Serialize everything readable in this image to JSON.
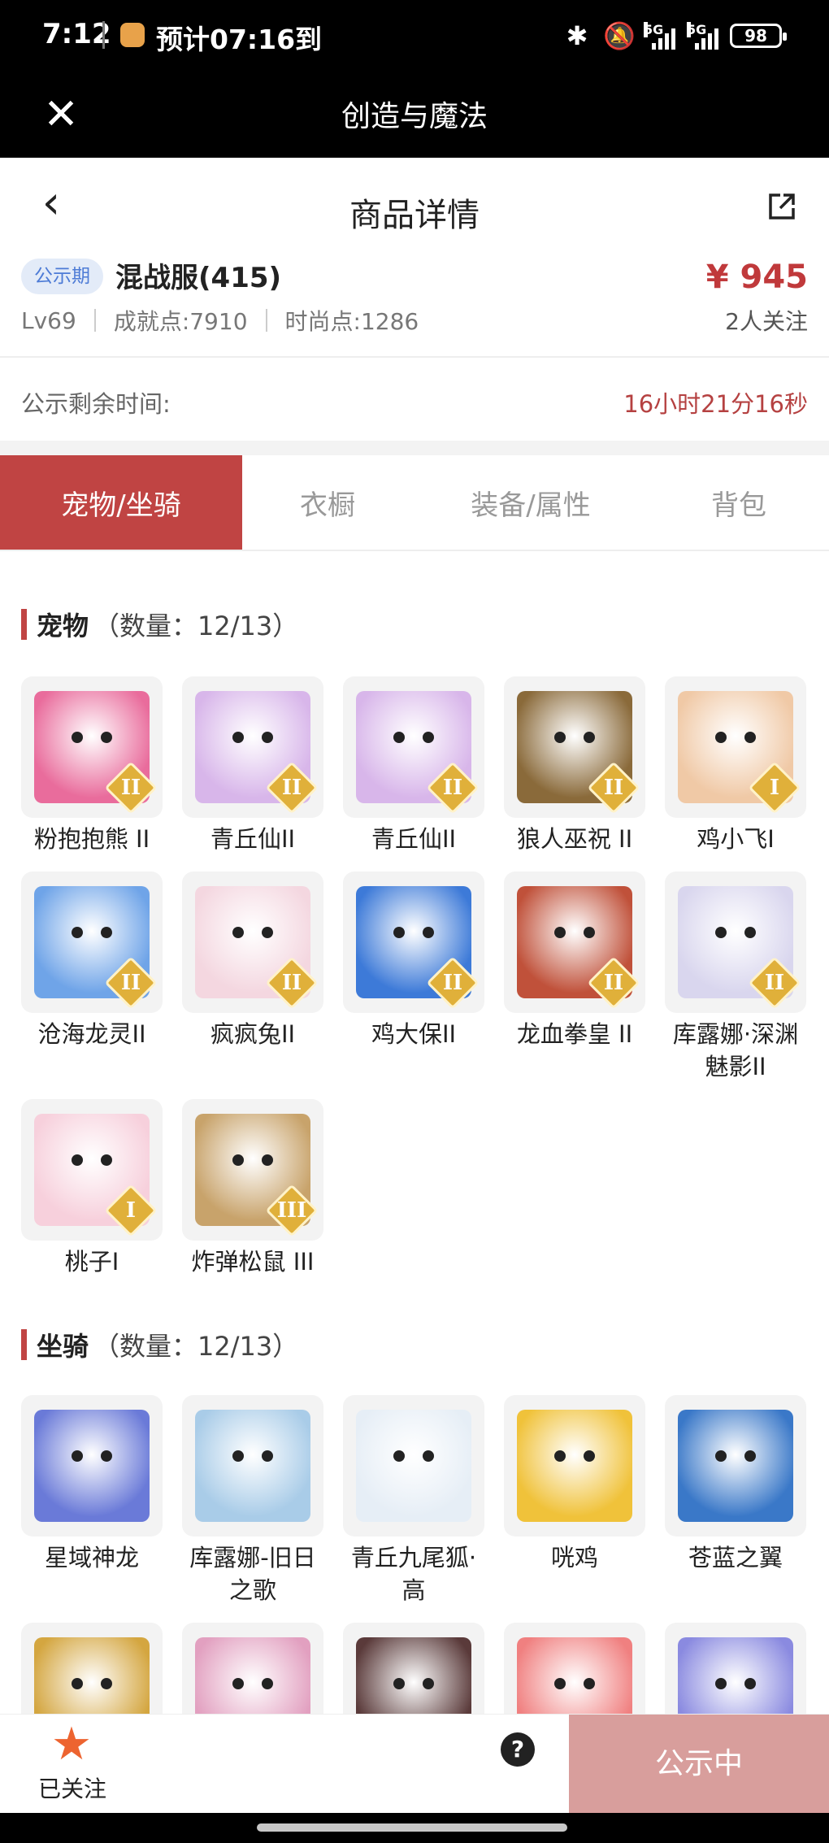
{
  "status_bar": {
    "time": "7:12",
    "eta": "预计07:16到",
    "network_a": "5G",
    "network_b": "5G",
    "battery": "98"
  },
  "app_bar": {
    "title": "创造与魔法",
    "close_icon": "close-icon"
  },
  "header": {
    "title": "商品详情",
    "back_icon": "chevron-left-icon",
    "share_icon": "external-link-icon"
  },
  "summary": {
    "badge": "公示期",
    "server": "混战服(415)",
    "price": "¥ 945",
    "level": "Lv69",
    "achievement": "成就点:7910",
    "fashion": "时尚点:1286",
    "followers": "2人关注"
  },
  "countdown": {
    "label": "公示剩余时间:",
    "value": "16小时21分16秒"
  },
  "tabs": [
    {
      "label": "宠物/坐骑",
      "active": true
    },
    {
      "label": "衣橱",
      "active": false
    },
    {
      "label": "装备/属性",
      "active": false
    },
    {
      "label": "背包",
      "active": false
    }
  ],
  "pets": {
    "title": "宠物",
    "count": "（数量：12/13）",
    "items": [
      {
        "name": "粉抱抱熊 II",
        "tier": "II",
        "color": "#e96c9c"
      },
      {
        "name": "青丘仙II",
        "tier": "II",
        "color": "#d8b6ea"
      },
      {
        "name": "青丘仙II",
        "tier": "II",
        "color": "#d8b6ea"
      },
      {
        "name": "狼人巫祝 II",
        "tier": "II",
        "color": "#8a6a3a"
      },
      {
        "name": "鸡小飞I",
        "tier": "I",
        "color": "#f0c9a6"
      },
      {
        "name": "沧海龙灵II",
        "tier": "II",
        "color": "#6fa4e8"
      },
      {
        "name": "疯疯兔II",
        "tier": "II",
        "color": "#f4d7e0"
      },
      {
        "name": "鸡大保II",
        "tier": "II",
        "color": "#3d7ad8"
      },
      {
        "name": "龙血拳皇 II",
        "tier": "II",
        "color": "#c0513a"
      },
      {
        "name": "库露娜·深渊魅影II",
        "tier": "II",
        "color": "#d9d6ee"
      },
      {
        "name": "桃子I",
        "tier": "I",
        "color": "#f7d0dc"
      },
      {
        "name": "炸弹松鼠 III",
        "tier": "III",
        "color": "#c8a36b"
      }
    ]
  },
  "mounts": {
    "title": "坐骑",
    "count": "（数量：12/13）",
    "items": [
      {
        "name": "星域神龙",
        "color": "#6a7ad8"
      },
      {
        "name": "库露娜-旧日之歌",
        "color": "#a9cce8"
      },
      {
        "name": "青丘九尾狐·高",
        "color": "#e6eef6"
      },
      {
        "name": "咣鸡",
        "color": "#f0c23a"
      },
      {
        "name": "苍蓝之翼",
        "color": "#3a78c8"
      },
      {
        "name": "",
        "color": "#d4a640"
      },
      {
        "name": "",
        "color": "#e2a0c0"
      },
      {
        "name": "",
        "color": "#5a3a3a"
      },
      {
        "name": "",
        "color": "#f08080"
      },
      {
        "name": "",
        "color": "#8a8ae0"
      }
    ]
  },
  "bottom_bar": {
    "follow_label": "已关注",
    "help_icon": "help-icon",
    "help_glyph": "?",
    "action_label": "公示中"
  }
}
